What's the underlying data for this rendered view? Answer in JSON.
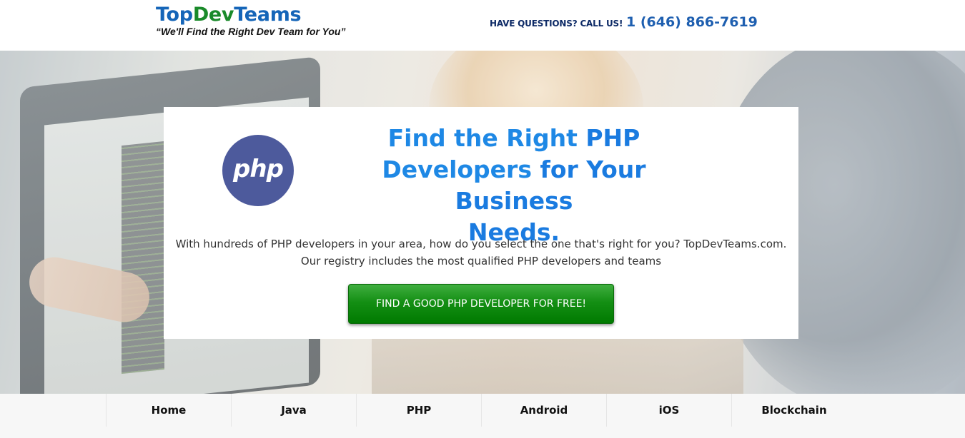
{
  "header": {
    "logo": {
      "part1": "Top",
      "part2": "Dev",
      "part3": "Teams"
    },
    "tagline": "“We'll Find the Right Dev Team for You”",
    "call_label": "HAVE QUESTIONS? CALL US!",
    "phone": "1 (646) 866-7619",
    "colors": {
      "brand_blue": "#1565b8",
      "brand_green": "#1a8a2a"
    }
  },
  "hero": {
    "logo_text": "php",
    "headline": {
      "line1_normal": "Find the Right ",
      "line1_bold": "PHP",
      "line2_normal": "Developers ",
      "line2_bold": "for Your Business",
      "line3_bold": "Needs."
    },
    "description_line1": "With hundreds of PHP developers in your area, how do you select the one that's right for you? TopDevTeams.com.",
    "description_line2": "Our registry includes the most qualified PHP developers and teams",
    "cta_label": "FIND A GOOD PHP DEVELOPER FOR FREE!",
    "colors": {
      "headline": "#1e88e5",
      "cta": "#148f14",
      "php_logo": "#4d5a9c"
    }
  },
  "nav": {
    "items": [
      {
        "label": "Home"
      },
      {
        "label": "Java"
      },
      {
        "label": "PHP"
      },
      {
        "label": "Android"
      },
      {
        "label": "iOS"
      },
      {
        "label": "Blockchain"
      }
    ]
  }
}
